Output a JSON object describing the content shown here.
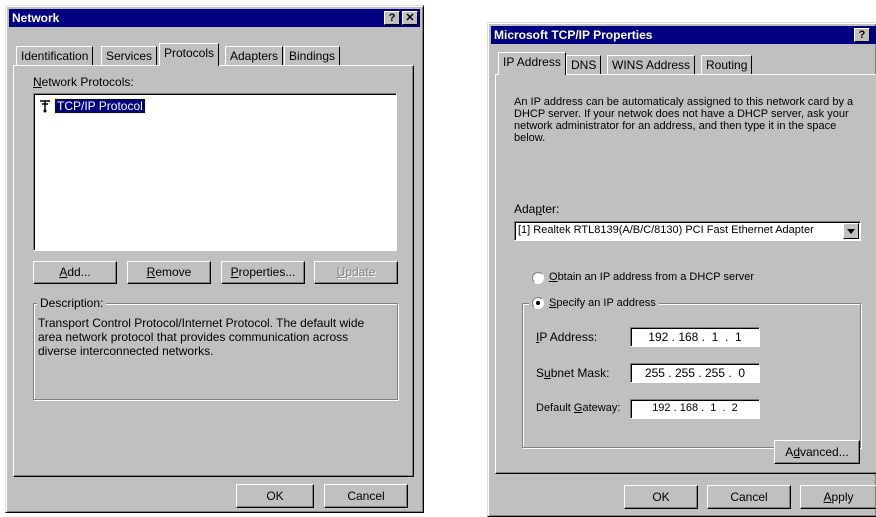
{
  "network": {
    "title": "Network",
    "help_btn": "?",
    "close_btn": "✕",
    "tabs": [
      "Identification",
      "Services",
      "Protocols",
      "Adapters",
      "Bindings"
    ],
    "protocols_label_pre": "",
    "protocols_label_ul": "N",
    "protocols_label_post": "etwork Protocols:",
    "protocol_item": "TCP/IP Protocol",
    "buttons": {
      "add_ul": "A",
      "add_post": "dd...",
      "remove_ul": "R",
      "remove_post": "emove",
      "properties_ul": "P",
      "properties_post": "roperties...",
      "update_ul": "U",
      "update_post": "pdate"
    },
    "description_label": "Description:",
    "description_text": "Transport Control Protocol/Internet Protocol. The default wide area network protocol that provides communication across diverse interconnected networks.",
    "ok": "OK",
    "cancel": "Cancel"
  },
  "tcpip": {
    "title": "Microsoft TCP/IP Properties",
    "help_btn": "?",
    "close_btn": "✕",
    "tabs": [
      "IP Address",
      "DNS",
      "WINS Address",
      "Routing"
    ],
    "info_text": "An IP address can be automaticaly assigned to this network card by a DHCP server.  If your netwok does not have a DHCP server, ask your network administrator for an address, and then type it in the space below.",
    "adapter_label_pre": "Ada",
    "adapter_label_ul": "p",
    "adapter_label_post": "ter:",
    "adapter_value": "[1] Realtek RTL8139(A/B/C/8130) PCI Fast Ethernet Adapter",
    "obtain_ul": "O",
    "obtain_post": "btain an IP address from a DHCP server",
    "specify_ul": "S",
    "specify_post": "pecify an IP address",
    "ip_label_ul": "I",
    "ip_label_post": "P Address:",
    "ip_value": "192 . 168 .  1  .  1",
    "subnet_label_pre": "S",
    "subnet_label_ul": "u",
    "subnet_label_post": "bnet Mask:",
    "subnet_value": "255 . 255 . 255 .  0",
    "gateway_label_pre": "Default ",
    "gateway_label_ul": "G",
    "gateway_label_post": "ateway:",
    "gateway_value": "192 . 168 .  1  .  2",
    "advanced_pre": "A",
    "advanced_ul": "d",
    "advanced_post": "vanced...",
    "ok": "OK",
    "cancel": "Cancel",
    "apply_ul": "A",
    "apply_post": "pply"
  }
}
